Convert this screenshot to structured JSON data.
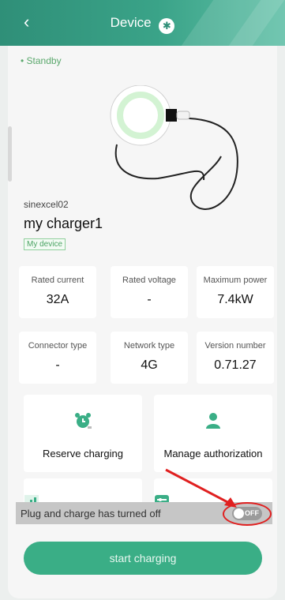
{
  "header": {
    "title": "Device",
    "bt_icon": "bluetooth-icon"
  },
  "status": {
    "text": "• Standby",
    "color": "#5aa86c"
  },
  "device": {
    "serial": "sinexcel02",
    "name": "my charger1",
    "tag": "My device"
  },
  "specs": [
    {
      "label": "Rated current",
      "value": "32A"
    },
    {
      "label": "Rated voltage",
      "value": "-"
    },
    {
      "label": "Maximum power",
      "value": "7.4kW"
    },
    {
      "label": "Connector type",
      "value": "-"
    },
    {
      "label": "Network type",
      "value": "4G"
    },
    {
      "label": "Version number",
      "value": "0.71.27"
    }
  ],
  "actions": [
    {
      "label": "Reserve charging",
      "icon": "alarm-clock-icon"
    },
    {
      "label": "Manage authorization",
      "icon": "user-icon"
    }
  ],
  "more_actions": [
    {
      "icon": "bar-chart-icon"
    },
    {
      "icon": "settings-sliders-icon"
    }
  ],
  "toast": {
    "message": "Plug and charge has turned off",
    "toggle_state": "OFF"
  },
  "primary_button": {
    "label": "start charging"
  },
  "colors": {
    "accent": "#3aae86",
    "header": "#2f8f78",
    "annotation": "#e02020"
  }
}
